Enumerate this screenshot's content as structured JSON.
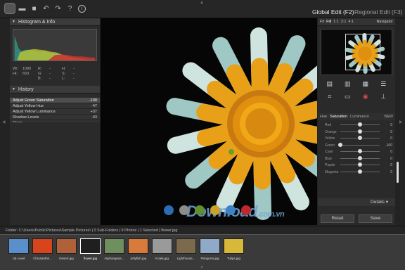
{
  "toolbar": {
    "global_edit": "Global Edit (F2)",
    "regional_edit": "Regional Edit (F3)",
    "help": "?",
    "info": "i"
  },
  "histogram": {
    "title": "Histogram & Info",
    "r1": [
      "Wi:",
      "1080",
      "R:",
      "-",
      "H:",
      "-"
    ],
    "r2": [
      "Ht:",
      "650",
      "G:",
      "-",
      "S:",
      "-"
    ],
    "r3": [
      "",
      "",
      "B:",
      "-",
      "L:",
      "-"
    ]
  },
  "history": {
    "title": "History",
    "items": [
      {
        "name": "Adjust Green Saturation",
        "value": "-100"
      },
      {
        "name": "Adjust Yellow Hue",
        "value": "-47"
      },
      {
        "name": "Adjust Yellow Luminance",
        "value": "+37"
      },
      {
        "name": "Shadow Levels",
        "value": "-43"
      },
      {
        "name": "Open",
        "value": ""
      }
    ]
  },
  "navigator": {
    "fit": "Fit",
    "fill": "Fill",
    "z1": "1:1",
    "z2": "2:1",
    "z3": "4:1",
    "title": "Navigator"
  },
  "hsl": {
    "hue": "Hue",
    "saturation": "Saturation",
    "luminance": "Luminance",
    "auto": "B&W",
    "rows": [
      {
        "label": "Red",
        "value": "0",
        "pos": 0.5
      },
      {
        "label": "Orange",
        "value": "0",
        "pos": 0.5
      },
      {
        "label": "Yellow",
        "value": "0",
        "pos": 0.5
      },
      {
        "label": "Green",
        "value": "-100",
        "pos": 0.0
      },
      {
        "label": "Cyan",
        "value": "0",
        "pos": 0.5
      },
      {
        "label": "Blue",
        "value": "0",
        "pos": 0.5
      },
      {
        "label": "Purple",
        "value": "0",
        "pos": 0.5
      },
      {
        "label": "Magenta",
        "value": "0",
        "pos": 0.5
      }
    ]
  },
  "details": "Details",
  "buttons": {
    "reset": "Reset",
    "save": "Save"
  },
  "status": "Folder:  C:\\Users\\Public\\Pictures\\Sample Pictures\\  |  0 Sub-Folders  |  9 Photos  |  1 Selected  |  flower.jpg",
  "watermark": {
    "main": "Download",
    "suffix": ".com.vn"
  },
  "dot_colors": [
    "#2b6cb5",
    "#8c8c8c",
    "#5f8f2f",
    "#c9a227",
    "#3c82c8",
    "#c0292b"
  ],
  "filmstrip": [
    {
      "name": "Up Level",
      "color": "#5a8fcc"
    },
    {
      "name": "Chrysanthe...",
      "color": "#d8451c"
    },
    {
      "name": "Desert.jpg",
      "color": "#b0613a"
    },
    {
      "name": "flower.jpg",
      "color": "#1f1f1f"
    },
    {
      "name": "Hydrangeas...",
      "color": "#6f8f5e"
    },
    {
      "name": "Jellyfish.jpg",
      "color": "#d87a3a"
    },
    {
      "name": "Koala.jpg",
      "color": "#9a9a9a"
    },
    {
      "name": "Lighthouse...",
      "color": "#7b6b4c"
    },
    {
      "name": "Penguins.jpg",
      "color": "#8fa9c9"
    },
    {
      "name": "Tulips.jpg",
      "color": "#d7b838"
    }
  ]
}
